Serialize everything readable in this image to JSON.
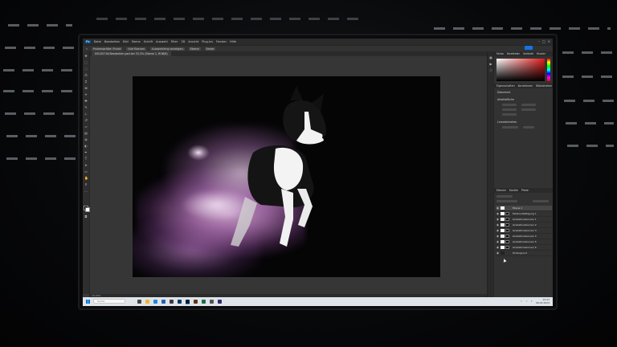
{
  "app": {
    "name": "Adobe Photoshop",
    "menu": [
      "Datei",
      "Bearbeiten",
      "Bild",
      "Ebene",
      "Schrift",
      "Auswahl",
      "Filter",
      "3D",
      "Ansicht",
      "Plug-ins",
      "Fenster",
      "Hilfe"
    ],
    "window_controls": [
      "–",
      "□",
      "×"
    ]
  },
  "options_bar": {
    "items": [
      "Probengröße: Punkt",
      "Alle Ebenen",
      "Auswahlring anzeigen",
      "Ebene",
      "Farbe"
    ]
  },
  "document": {
    "tab_title": "DSC05716-Bearbeiten.psd bei 33,3% (Ebene 1, RGB/8)",
    "zoom": "33,33%"
  },
  "contextual_taskbar": {
    "buttons": [
      "Motiv auswählen",
      "Hintergrund entfernen",
      "Auswahl",
      "•••"
    ]
  },
  "right_panel": {
    "top_tabs": [
      "Farbe",
      "Farbfelder",
      "Verläufe",
      "Muster"
    ],
    "properties_tabs": [
      "Eigenschaften",
      "Korrekturen",
      "Bibliotheken"
    ],
    "sections": [
      "Dokument",
      "Arbeitsfläche",
      "Linealeinheiten"
    ],
    "layers_tabs": [
      "Ebenen",
      "Kanäle",
      "Pfade"
    ],
    "layers": [
      {
        "name": "Ebene 1",
        "selected": true
      },
      {
        "name": "Farbton/Sättigung 1",
        "selected": false
      },
      {
        "name": "Gradationskurven 1",
        "selected": false
      },
      {
        "name": "Gradationskurven 2",
        "selected": false
      },
      {
        "name": "Gradationskurven 3",
        "selected": false
      },
      {
        "name": "Gradationskurven 4",
        "selected": false
      },
      {
        "name": "Gradationskurven 5",
        "selected": false
      },
      {
        "name": "Gradationskurven 6",
        "selected": false
      },
      {
        "name": "Hintergrund",
        "selected": false
      }
    ]
  },
  "taskbar": {
    "search_placeholder": "Suche",
    "tray_time": "12:47",
    "tray_date": "08.03.2024"
  },
  "colors": {
    "ps_dark": "#323232",
    "accent_blue": "#1473e6",
    "smoke_pink": "#c88ccb"
  }
}
